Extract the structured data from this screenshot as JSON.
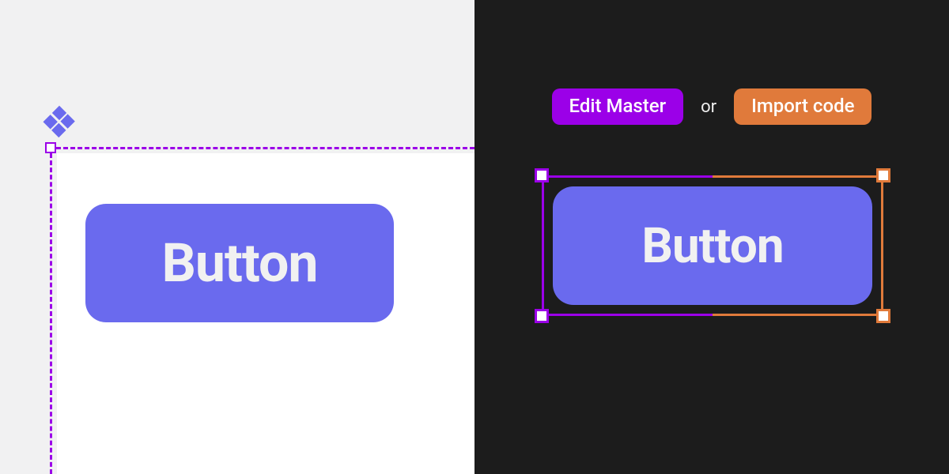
{
  "left": {
    "component_icon": "component-diamond-icon",
    "button_label": "Button"
  },
  "right": {
    "edit_master_label": "Edit Master",
    "or_label": "or",
    "import_code_label": "Import code",
    "button_label": "Button"
  },
  "colors": {
    "master_purple": "#9b00e8",
    "code_orange": "#e07a3b",
    "component_fill": "#6a6aee"
  }
}
